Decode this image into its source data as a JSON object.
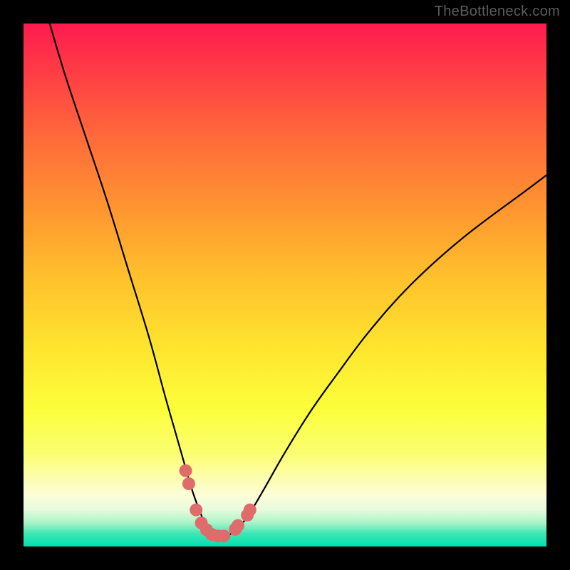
{
  "watermark": {
    "text": "TheBottleneck.com"
  },
  "colors": {
    "background": "#000000",
    "curve_stroke": "#000000",
    "dot_fill": "#e06b6b",
    "gradient_stops": [
      "#ff1a4f",
      "#ff3846",
      "#ff6b3a",
      "#ff9430",
      "#ffbf2c",
      "#ffe52e",
      "#fcff3c",
      "#fbfe6f",
      "#fdfdd6",
      "#e7fbde",
      "#a7f4c7",
      "#3fe6b5",
      "#00e0b0"
    ]
  },
  "chart_data": {
    "type": "line",
    "title": "",
    "xlabel": "",
    "ylabel": "",
    "xlim": [
      0,
      100
    ],
    "ylim": [
      0,
      100
    ],
    "series": [
      {
        "name": "bottleneck-curve",
        "x": [
          5,
          8,
          12,
          16,
          20,
          24,
          27,
          29,
          31,
          32.5,
          34,
          35,
          36,
          37,
          38.5,
          40.5,
          43,
          46,
          50,
          55,
          60,
          66,
          74,
          84,
          96,
          100
        ],
        "y": [
          100,
          90,
          78,
          66,
          53,
          40,
          29,
          22,
          15,
          10,
          6,
          3.5,
          2.2,
          1.8,
          2.0,
          3.0,
          6,
          11,
          18,
          26,
          33,
          41,
          50,
          59,
          68,
          71
        ]
      }
    ],
    "dots": {
      "name": "highlight-points",
      "x": [
        31.0,
        31.6,
        33.0,
        34.0,
        35.0,
        36.0,
        37.2,
        38.3,
        40.5,
        41.0,
        42.8,
        43.3
      ],
      "y": [
        14.5,
        12.0,
        7.0,
        4.5,
        3.2,
        2.3,
        2.0,
        2.0,
        3.3,
        4.0,
        6.0,
        7.0
      ]
    }
  }
}
